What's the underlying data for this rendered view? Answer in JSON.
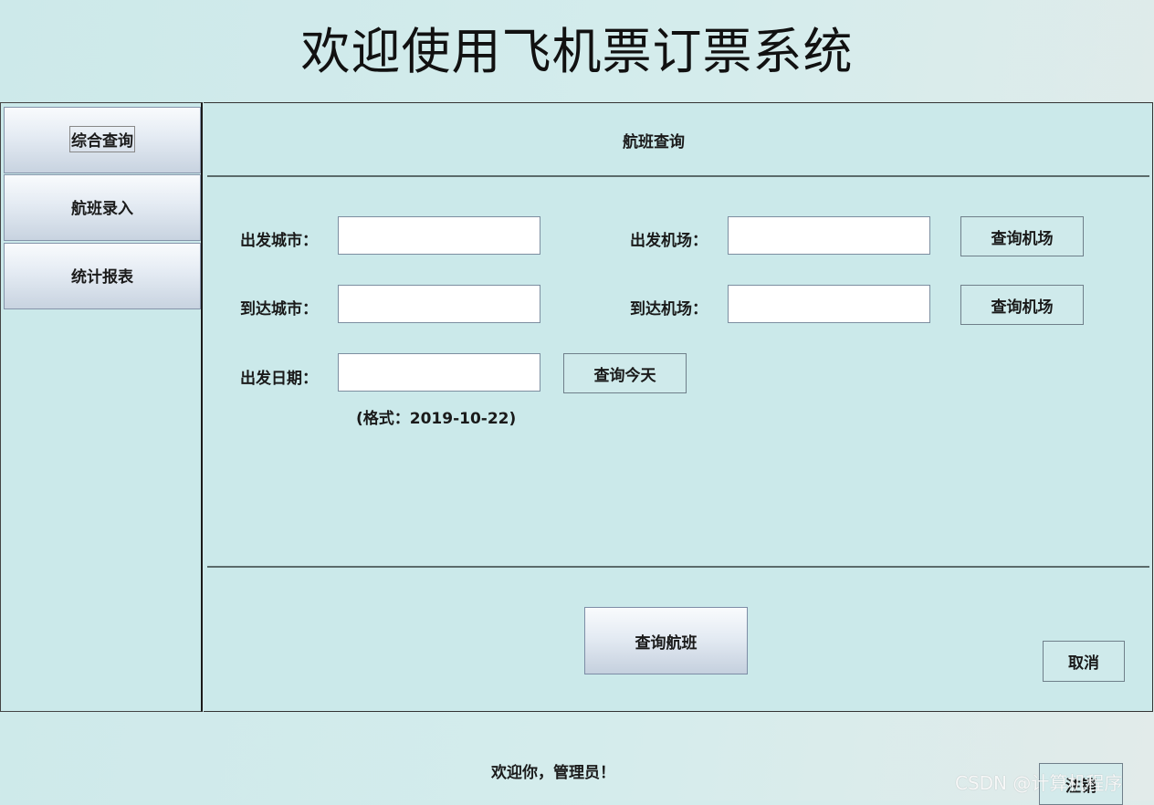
{
  "header": {
    "title": "欢迎使用飞机票订票系统"
  },
  "sidebar": {
    "items": [
      {
        "label": "综合查询",
        "active": true
      },
      {
        "label": "航班录入",
        "active": false
      },
      {
        "label": "统计报表",
        "active": false
      }
    ]
  },
  "main": {
    "panel_title": "航班查询",
    "form": {
      "departure_city_label": "出发城市：",
      "departure_city_value": "",
      "departure_airport_label": "出发机场：",
      "departure_airport_value": "",
      "query_departure_airport_button": "查询机场",
      "arrival_city_label": "到达城市：",
      "arrival_city_value": "",
      "arrival_airport_label": "到达机场：",
      "arrival_airport_value": "",
      "query_arrival_airport_button": "查询机场",
      "departure_date_label": "出发日期：",
      "departure_date_value": "",
      "query_today_button": "查询今天",
      "date_format_hint": "(格式：2019-10-22)"
    },
    "search_flights_button": "查询航班",
    "cancel_button": "取消"
  },
  "footer": {
    "welcome_text": "欢迎你，管理员！",
    "logout_button": "注销",
    "watermark": "CSDN @计算机程序"
  }
}
